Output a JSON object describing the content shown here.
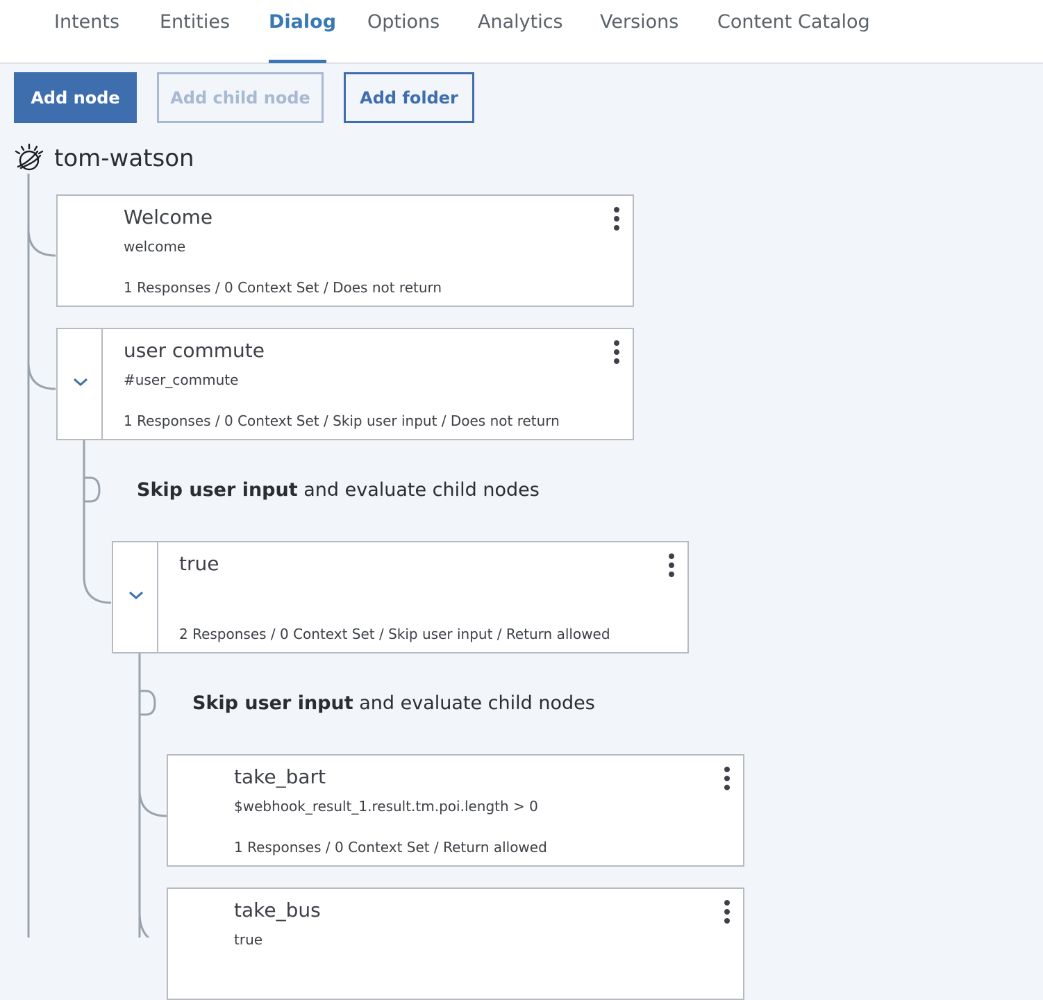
{
  "tabs": [
    {
      "label": "Intents",
      "active": false
    },
    {
      "label": "Entities",
      "active": false
    },
    {
      "label": "Dialog",
      "active": true
    },
    {
      "label": "Options",
      "active": false
    },
    {
      "label": "Analytics",
      "active": false
    },
    {
      "label": "Versions",
      "active": false
    },
    {
      "label": "Content Catalog",
      "active": false
    }
  ],
  "toolbar": {
    "add_node": "Add node",
    "add_child_node": "Add child node",
    "add_folder": "Add folder"
  },
  "workspace": {
    "name": "tom-watson",
    "icon": "ibm-watson-icon"
  },
  "nodes": [
    {
      "title": "Welcome",
      "condition": "welcome",
      "summary": "1 Responses / 0 Context Set / Does not return",
      "expandable": false
    },
    {
      "title": "user commute",
      "condition": "#user_commute",
      "summary": "1 Responses / 0 Context Set / Skip user input / Does not return",
      "expandable": true
    },
    {
      "title": "true",
      "condition": "",
      "summary": "2 Responses / 0 Context Set / Skip user input / Return allowed",
      "expandable": true
    },
    {
      "title": "take_bart",
      "condition": "$webhook_result_1.result.tm.poi.length > 0",
      "summary": "1 Responses / 0 Context Set / Return allowed",
      "expandable": false
    },
    {
      "title": "take_bus",
      "condition": "true",
      "summary": "",
      "expandable": false
    }
  ],
  "skip_notes": [
    {
      "bold": "Skip user input",
      "rest": " and evaluate child nodes"
    },
    {
      "bold": "Skip user input",
      "rest": " and evaluate child nodes"
    }
  ],
  "colors": {
    "accent": "#3a78b5",
    "primary_button": "#3f6eaf",
    "disabled_button": "#a7b9d3",
    "connector_line": "#9aa3ab",
    "background": "#f2f5f9"
  }
}
